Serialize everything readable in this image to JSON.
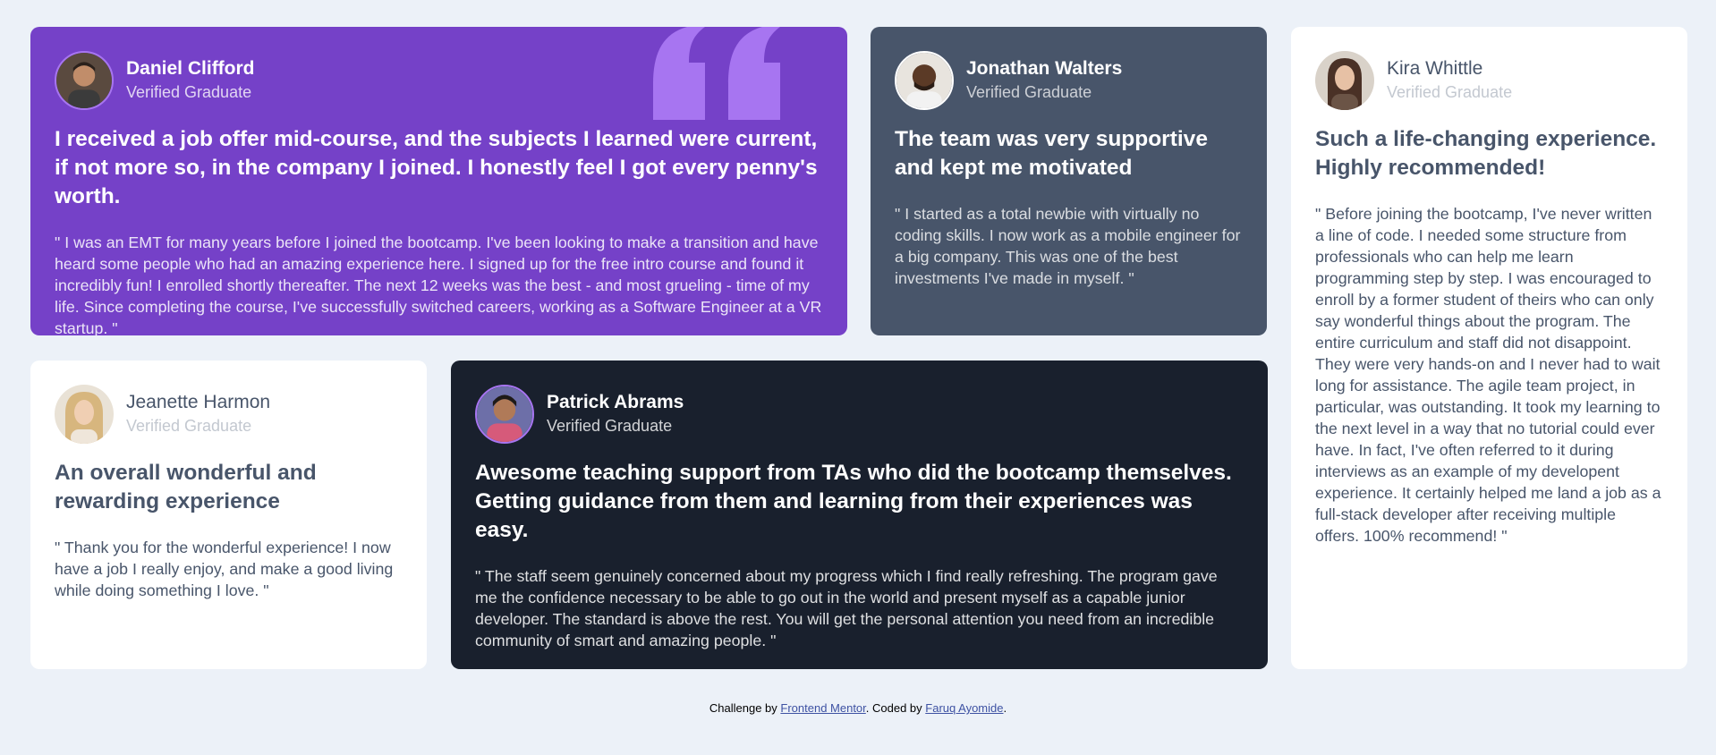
{
  "colors": {
    "background": "#ecf1f8",
    "purple": "#7541c8",
    "gray": "#48556a",
    "dark": "#19202d",
    "white": "#ffffff",
    "quote_mark": "#a775f1",
    "link": "#3e52a3"
  },
  "testimonials": [
    {
      "name": "Daniel Clifford",
      "role": "Verified Graduate",
      "title": "I received a job offer mid-course, and the subjects I learned were current, if not more so, in the company I joined. I honestly feel I got every penny's worth.",
      "body": "\" I was an EMT for many years before I joined the bootcamp. I've been looking to make a transition and have heard some people who had an amazing experience here. I signed up for the free intro course and found it incredibly fun! I enrolled shortly thereafter. The next 12 weeks was the best - and most grueling - time of my life. Since completing the course, I've successfully switched careers, working as a Software Engineer at a VR startup. \""
    },
    {
      "name": "Jonathan Walters",
      "role": "Verified Graduate",
      "title": "The team was very supportive and kept me motivated",
      "body": "\" I started as a total newbie with virtually no coding skills. I now work as a mobile engineer for a big company. This was one of the best investments I've made in myself. \""
    },
    {
      "name": "Kira Whittle",
      "role": "Verified Graduate",
      "title": "Such a life-changing experience. Highly recommended!",
      "body": "\" Before joining the bootcamp, I've never written a line of code. I needed some structure from professionals who can help me learn programming step by step. I was encouraged to enroll by a former student of theirs who can only say wonderful things about the program. The entire curriculum and staff did not disappoint. They were very hands-on and I never had to wait long for assistance. The agile team project, in particular, was outstanding. It took my learning to the next level in a way that no tutorial could ever have. In fact, I've often referred to it during interviews as an example of my developent experience. It certainly helped me land a job as a full-stack developer after receiving multiple offers. 100% recommend! \""
    },
    {
      "name": "Jeanette Harmon",
      "role": "Verified Graduate",
      "title": "An overall wonderful and rewarding experience",
      "body": "\" Thank you for the wonderful experience! I now have a job I really enjoy, and make a good living while doing something I love. \""
    },
    {
      "name": "Patrick Abrams",
      "role": "Verified Graduate",
      "title": "Awesome teaching support from TAs who did the bootcamp themselves. Getting guidance from them and learning from their experiences was easy.",
      "body": "\" The staff seem genuinely concerned about my progress which I find really refreshing. The program gave me the confidence necessary to be able to go out in the world and present myself as a capable junior developer. The standard is above the rest. You will get the personal attention you need from an incredible community of smart and amazing people. \""
    }
  ],
  "footer": {
    "prefix": "Challenge by ",
    "link1": "Frontend Mentor",
    "middle": ". Coded by ",
    "link2": "Faruq Ayomide",
    "suffix": "."
  }
}
